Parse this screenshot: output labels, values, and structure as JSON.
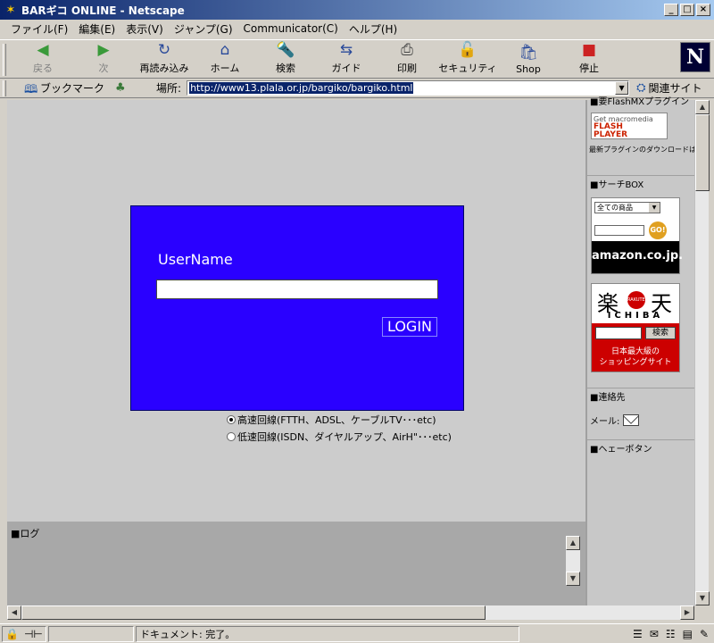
{
  "window": {
    "title": "BARギコ ONLINE - Netscape",
    "minimize": "_",
    "maximize": "□",
    "close": "×"
  },
  "menu": [
    "ファイル(F)",
    "編集(E)",
    "表示(V)",
    "ジャンプ(G)",
    "Communicator(C)",
    "ヘルプ(H)"
  ],
  "toolbar": {
    "buttons": [
      {
        "label": "戻る",
        "icon": "back-arrow-icon",
        "glyph": "◀",
        "enabled": false
      },
      {
        "label": "次",
        "icon": "forward-arrow-icon",
        "glyph": "▶",
        "enabled": false
      },
      {
        "label": "再読み込み",
        "icon": "reload-icon",
        "glyph": "↻",
        "enabled": true
      },
      {
        "label": "ホーム",
        "icon": "home-icon",
        "glyph": "⌂",
        "enabled": true
      },
      {
        "label": "検索",
        "icon": "search-icon",
        "glyph": "🔦",
        "enabled": true
      },
      {
        "label": "ガイド",
        "icon": "guide-icon",
        "glyph": "⇆",
        "enabled": true
      },
      {
        "label": "印刷",
        "icon": "print-icon",
        "glyph": "⎙",
        "enabled": true
      },
      {
        "label": "セキュリティ",
        "icon": "security-lock-icon",
        "glyph": "🔓",
        "enabled": true
      },
      {
        "label": "Shop",
        "icon": "shop-icon",
        "glyph": "🛍",
        "enabled": true
      },
      {
        "label": "停止",
        "icon": "stop-icon",
        "glyph": "■",
        "enabled": true
      }
    ],
    "logo": "N"
  },
  "location": {
    "bookmark_label": "ブックマーク",
    "location_label": "場所:",
    "url": "http://www13.plala.or.jp/bargiko/bargiko.html",
    "related_label": "関連サイト"
  },
  "login": {
    "label": "UserName",
    "button": "LOGIN",
    "options": [
      {
        "label": "高速回線(FTTH、ADSL、ケーブルTV･･･etc)",
        "selected": true
      },
      {
        "label": "低速回線(ISDN、ダイヤルアップ、AirH\"･･･etc)",
        "selected": false
      }
    ],
    "box_color": "#2a00ff"
  },
  "log": {
    "title": "■ログ"
  },
  "sidebar": {
    "flash_title": "■要FlashMXプラグイン",
    "flash_line1": "Get macromedia",
    "flash_line2": "FLASH",
    "flash_line3": "PLAYER",
    "flash_note": "最新プラグインのダウンロードは",
    "search_title": "■サーチBOX",
    "amazon_select": "全ての商品",
    "amazon_go": "GO!",
    "amazon_brand": "amazon.co.jp.",
    "rakuten_k1": "楽",
    "rakuten_k2": "天",
    "rakuten_dot": "RAKUTEN",
    "rakuten_ichiba": "ICHIBA",
    "rakuten_search": "検索",
    "rakuten_tag1": "日本最大級の",
    "rakuten_tag2": "ショッピングサイト",
    "contact_title": "■連絡先",
    "mail_label": "メール:",
    "hey_title": "■ヘェーボタン"
  },
  "status": {
    "text": "ドキュメント: 完了。"
  }
}
